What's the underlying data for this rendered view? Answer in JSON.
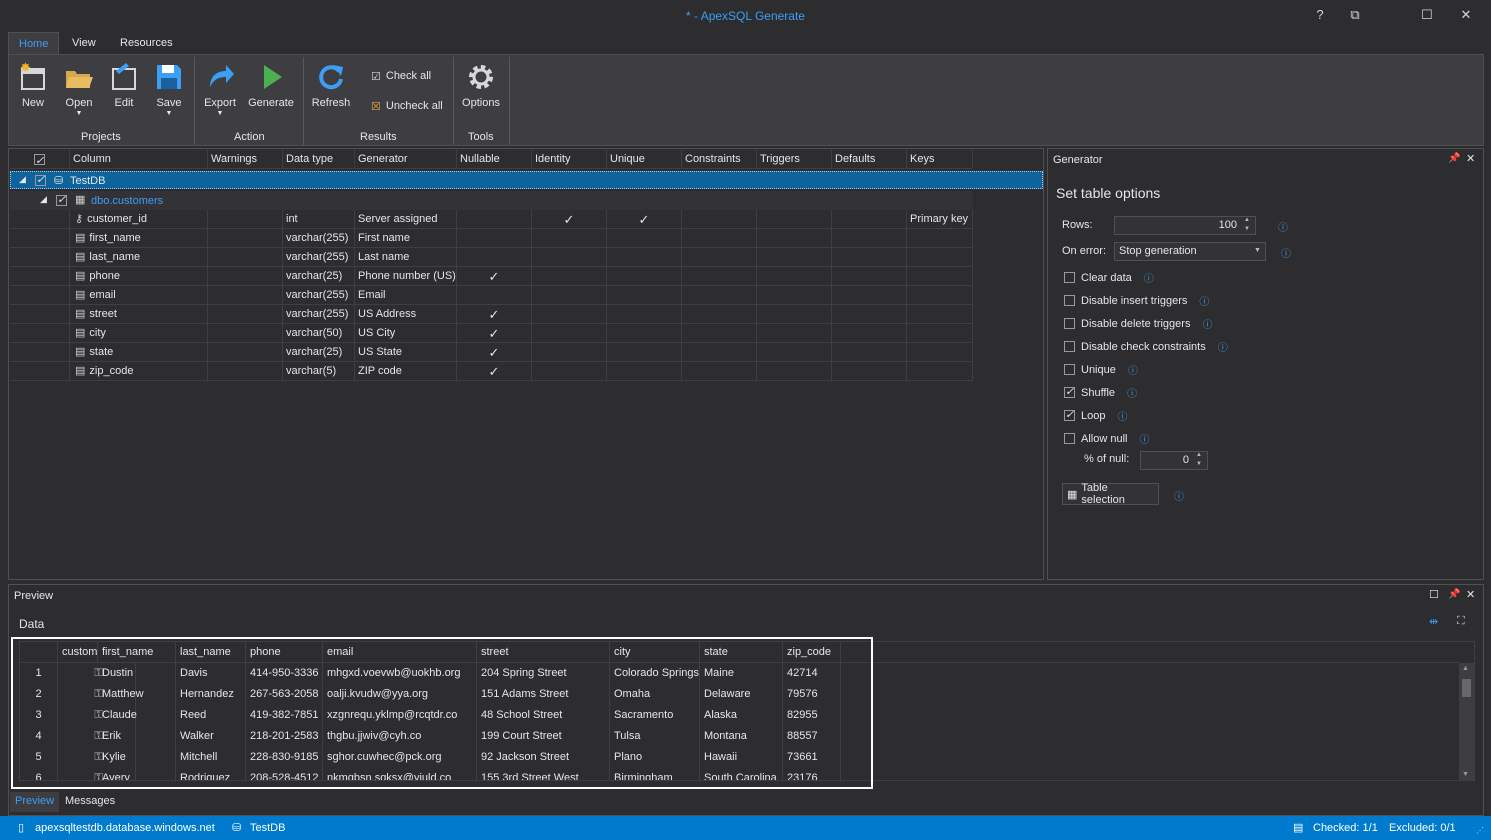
{
  "window": {
    "title": "* - ApexSQL Generate",
    "help": "?",
    "restore_down": "⧉",
    "maximize": "☐",
    "close": "✕"
  },
  "tabs": [
    "Home",
    "View",
    "Resources"
  ],
  "ribbon": {
    "buttons": {
      "new": "New",
      "open": "Open",
      "edit": "Edit",
      "save": "Save",
      "export": "Export",
      "generate": "Generate",
      "refresh": "Refresh",
      "options": "Options"
    },
    "check_all": "Check all",
    "uncheck_all": "Uncheck all",
    "groups": {
      "projects": "Projects",
      "action": "Action",
      "results": "Results",
      "tools": "Tools"
    }
  },
  "grid": {
    "headers": [
      "Column",
      "Warnings",
      "Data type",
      "Generator",
      "Nullable",
      "Identity",
      "Unique",
      "Constraints",
      "Triggers",
      "Defaults",
      "Keys"
    ],
    "db": "TestDB",
    "table": "dbo.customers",
    "rows": [
      {
        "column": "customer_id",
        "type": "int",
        "generator": "Server assigned",
        "nullable": "",
        "identity": "✓",
        "unique": "✓",
        "keys": "Primary key"
      },
      {
        "column": "first_name",
        "type": "varchar(255)",
        "generator": "First name",
        "nullable": "",
        "identity": "",
        "unique": "",
        "keys": ""
      },
      {
        "column": "last_name",
        "type": "varchar(255)",
        "generator": "Last name",
        "nullable": "",
        "identity": "",
        "unique": "",
        "keys": ""
      },
      {
        "column": "phone",
        "type": "varchar(25)",
        "generator": "Phone number (US)",
        "nullable": "✓",
        "identity": "",
        "unique": "",
        "keys": ""
      },
      {
        "column": "email",
        "type": "varchar(255)",
        "generator": "Email",
        "nullable": "",
        "identity": "",
        "unique": "",
        "keys": ""
      },
      {
        "column": "street",
        "type": "varchar(255)",
        "generator": "US Address",
        "nullable": "✓",
        "identity": "",
        "unique": "",
        "keys": ""
      },
      {
        "column": "city",
        "type": "varchar(50)",
        "generator": "US City",
        "nullable": "✓",
        "identity": "",
        "unique": "",
        "keys": ""
      },
      {
        "column": "state",
        "type": "varchar(25)",
        "generator": "US State",
        "nullable": "✓",
        "identity": "",
        "unique": "",
        "keys": ""
      },
      {
        "column": "zip_code",
        "type": "varchar(5)",
        "generator": "ZIP code",
        "nullable": "✓",
        "identity": "",
        "unique": "",
        "keys": ""
      }
    ]
  },
  "generator": {
    "panel_title": "Generator",
    "heading": "Set table options",
    "rows_label": "Rows:",
    "rows_value": "100",
    "on_error_label": "On error:",
    "on_error_value": "Stop generation",
    "options": [
      {
        "label": "Clear data",
        "checked": false
      },
      {
        "label": "Disable insert triggers",
        "checked": false
      },
      {
        "label": "Disable delete triggers",
        "checked": false
      },
      {
        "label": "Disable check constraints",
        "checked": false
      },
      {
        "label": "Unique",
        "checked": false
      },
      {
        "label": "Shuffle",
        "checked": true
      },
      {
        "label": "Loop",
        "checked": true
      },
      {
        "label": "Allow null",
        "checked": false
      }
    ],
    "pct_null_label": "% of null:",
    "pct_null_value": "0",
    "table_selection": "Table selection",
    "info_icon": "ⓘ"
  },
  "preview": {
    "panel_title": "Preview",
    "data_label": "Data",
    "headers": [
      "customer_id",
      "first_name",
      "last_name",
      "phone",
      "email",
      "street",
      "city",
      "state",
      "zip_code"
    ],
    "key_icon": "⚿",
    "rows": [
      {
        "n": "1",
        "first": "Dustin",
        "last": "Davis",
        "phone": "414-950-3336",
        "email": "mhgxd.voevwb@uokhb.org",
        "street": "204 Spring Street",
        "city": "Colorado Springs",
        "state": "Maine",
        "zip": "42714"
      },
      {
        "n": "2",
        "first": "Matthew",
        "last": "Hernandez",
        "phone": "267-563-2058",
        "email": "oalji.kvudw@yya.org",
        "street": "151 Adams Street",
        "city": "Omaha",
        "state": "Delaware",
        "zip": "79576"
      },
      {
        "n": "3",
        "first": "Claude",
        "last": "Reed",
        "phone": "419-382-7851",
        "email": "xzgnrequ.yklmp@rcqtdr.co",
        "street": "48 School Street",
        "city": "Sacramento",
        "state": "Alaska",
        "zip": "82955"
      },
      {
        "n": "4",
        "first": "Erik",
        "last": "Walker",
        "phone": "218-201-2583",
        "email": "thgbu.jjwiv@cyh.co",
        "street": "199 Court Street",
        "city": "Tulsa",
        "state": "Montana",
        "zip": "88557"
      },
      {
        "n": "5",
        "first": "Kylie",
        "last": "Mitchell",
        "phone": "228-830-9185",
        "email": "sghor.cuwhec@pck.org",
        "street": "92 Jackson Street",
        "city": "Plano",
        "state": "Hawaii",
        "zip": "73661"
      },
      {
        "n": "6",
        "first": "Avery",
        "last": "Rodriguez",
        "phone": "208-528-4512",
        "email": "nkmqbsn.sqksx@yiuld.co",
        "street": "155 3rd Street West",
        "city": "Birmingham",
        "state": "South Carolina",
        "zip": "23176"
      }
    ]
  },
  "bottom_tabs": [
    "Preview",
    "Messages"
  ],
  "status": {
    "server": "apexsqltestdb.database.windows.net",
    "db": "TestDB",
    "checked": "Checked: 1/1",
    "excluded": "Excluded: 0/1"
  },
  "colors": {
    "accent": "#3c9ef4",
    "selection": "#0e639c",
    "status_bar": "#007acc"
  }
}
